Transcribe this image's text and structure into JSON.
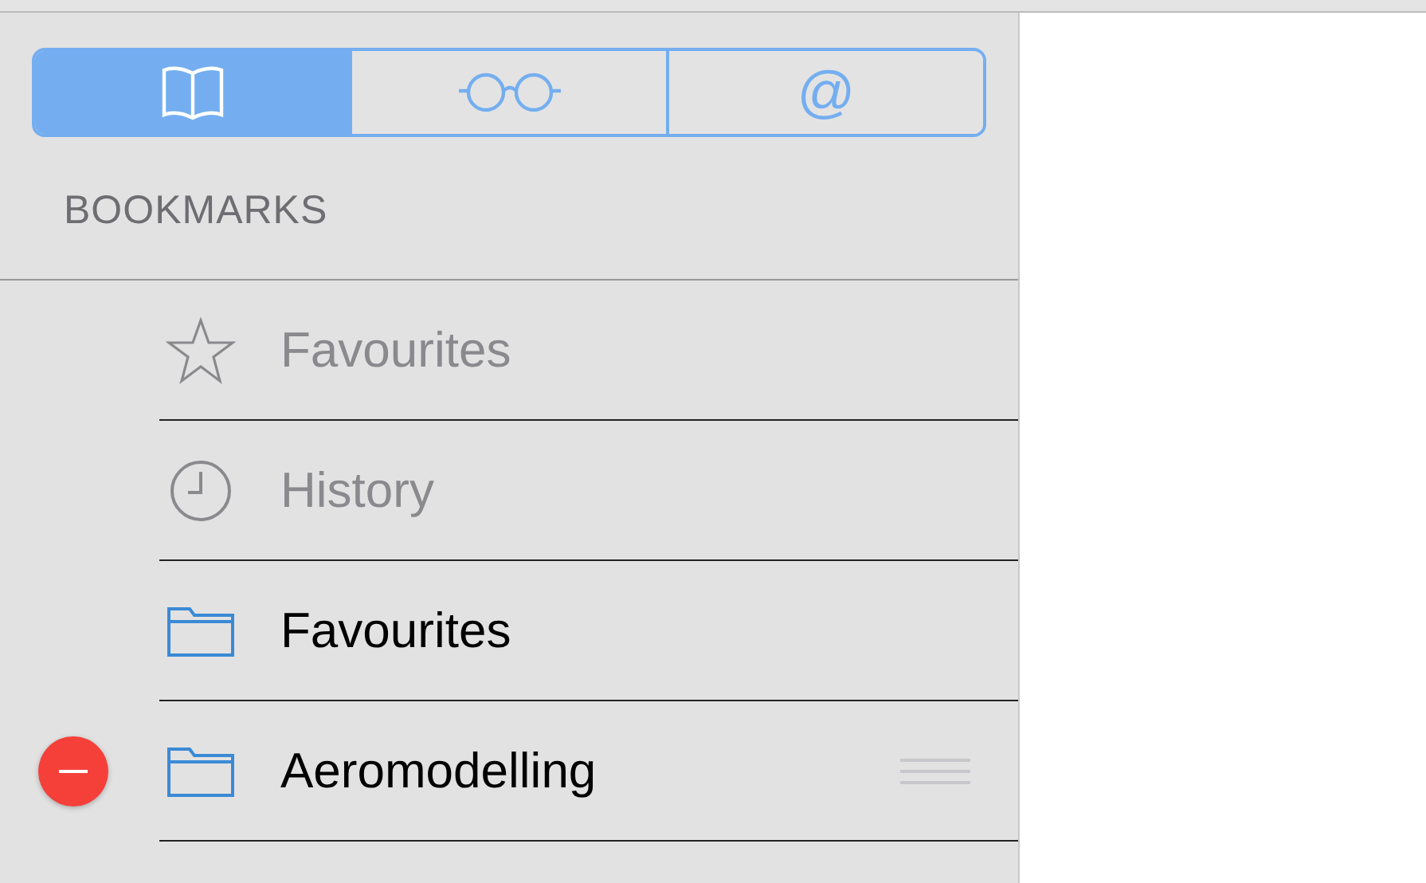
{
  "tabs": [
    {
      "kind": "book",
      "selected": true
    },
    {
      "kind": "glasses",
      "selected": false
    },
    {
      "kind": "at",
      "label": "@",
      "selected": false
    }
  ],
  "section_title": "BOOKMARKS",
  "items": [
    {
      "kind": "star",
      "label": "Favourites",
      "disabled": true,
      "deletable": false,
      "reorderable": false
    },
    {
      "kind": "clock",
      "label": "History",
      "disabled": true,
      "deletable": false,
      "reorderable": false
    },
    {
      "kind": "folder",
      "label": "Favourites",
      "disabled": false,
      "deletable": false,
      "reorderable": false
    },
    {
      "kind": "folder",
      "label": "Aeromodelling",
      "disabled": false,
      "deletable": true,
      "reorderable": true
    }
  ]
}
